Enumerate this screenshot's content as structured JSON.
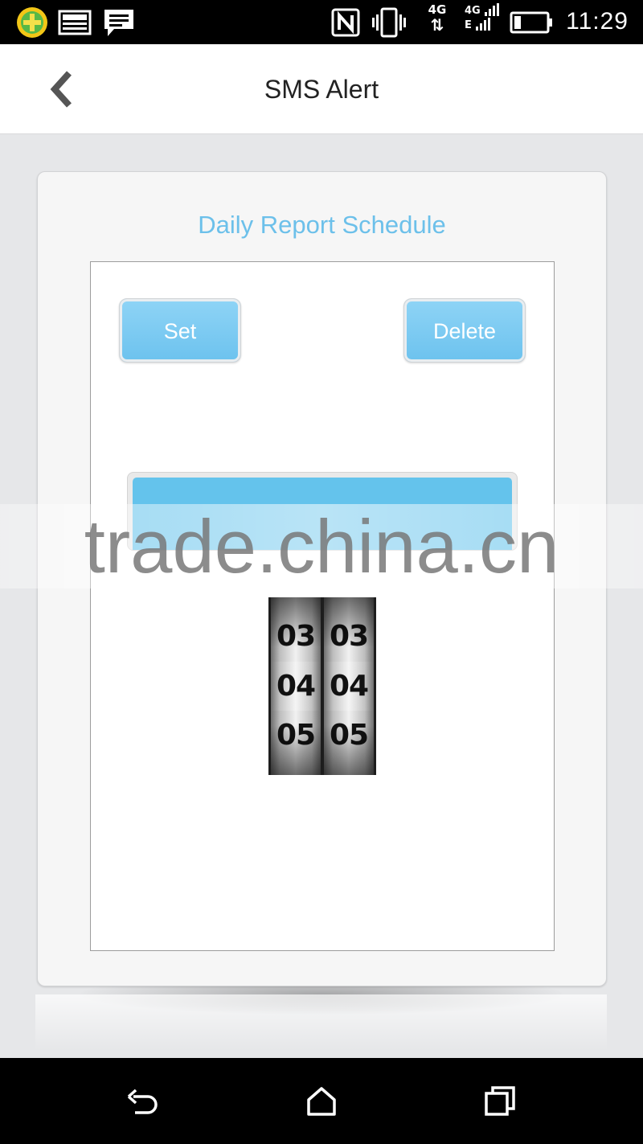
{
  "status_bar": {
    "time": "11:29",
    "network_top": "4G",
    "network_2_top": "4G",
    "network_2_bottom": "E",
    "icons": [
      "plus-badge-icon",
      "image-notification-icon",
      "message-notification-icon",
      "nfc-icon",
      "vibrate-icon",
      "data-transfer-icon",
      "signal-icon",
      "battery-icon"
    ]
  },
  "header": {
    "title": "SMS Alert",
    "back_icon": "chevron-left-icon"
  },
  "card": {
    "title": "Daily Report Schedule",
    "set_label": "Set",
    "delete_label": "Delete",
    "time_picker": {
      "hours": [
        "03",
        "04",
        "05"
      ],
      "minutes": [
        "03",
        "04",
        "05"
      ],
      "selected_hour": "04",
      "selected_minute": "04"
    }
  },
  "watermark": "trade.china.cn",
  "nav_bar": {
    "icons": [
      "back-icon",
      "home-icon",
      "recent-apps-icon"
    ]
  },
  "colors": {
    "accent": "#6cc0ea",
    "bar": "#64c3ec",
    "background": "#e6e7e9"
  }
}
